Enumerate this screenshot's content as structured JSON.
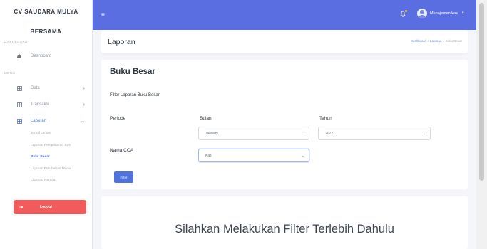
{
  "sidebar": {
    "brand_line1": "CV SAUDARA MULYA",
    "brand_line2": "BERSAMA",
    "section_dashboard": "DASHBOARD",
    "section_menu": "MENU",
    "items": [
      {
        "label": "Dashboard",
        "icon": "dashboard-icon"
      },
      {
        "label": "Data",
        "icon": "grid-icon"
      },
      {
        "label": "Transaksi",
        "icon": "grid-icon"
      },
      {
        "label": "Laporan",
        "icon": "grid-icon"
      }
    ],
    "laporan_sub": [
      {
        "label": "Jurnal Umum"
      },
      {
        "label": "Laporan Pengeluaran Kas"
      },
      {
        "label": "Buku Besar"
      },
      {
        "label": "Laporan Perubahan Modal"
      },
      {
        "label": "Laporan Neraca"
      }
    ],
    "logout_label": "Logout"
  },
  "topbar": {
    "user_name": "Manajemen kas",
    "accent": "#5b6ee1"
  },
  "header": {
    "title": "Laporan",
    "breadcrumb": {
      "home": "Dashboard",
      "parent": "Laporan",
      "current": "Buku Besar"
    }
  },
  "card": {
    "title": "Buku Besar",
    "filter_title": "Filter Laporan Buku Besar",
    "periode_label": "Periode",
    "bulan_label": "Bulan",
    "tahun_label": "Tahun",
    "bulan_value": "January",
    "tahun_value": "2022",
    "coa_label": "Nama COA",
    "coa_value": "Kas",
    "filter_button": "Filter"
  },
  "empty_message": "Silahkan Melakukan Filter Terlebih Dahulu",
  "colors": {
    "primary": "#4e73df",
    "logout": "#f25b5b"
  }
}
